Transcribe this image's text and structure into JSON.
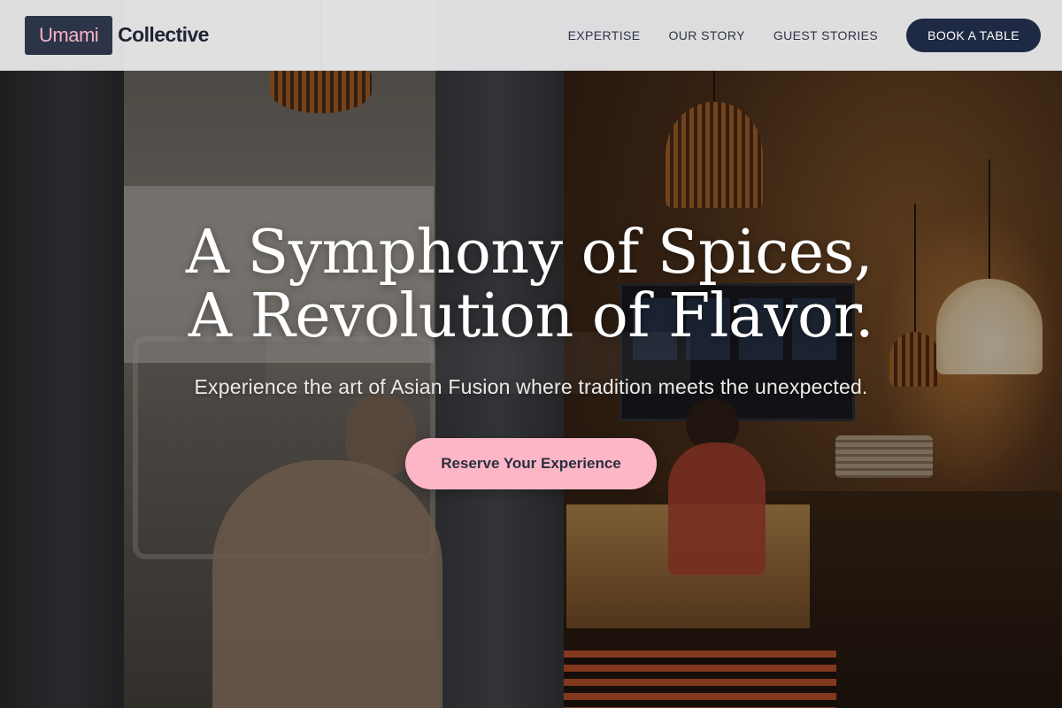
{
  "header": {
    "logo": {
      "highlight": "Umami",
      "rest": "Collective"
    },
    "nav": [
      {
        "label": "EXPERTISE"
      },
      {
        "label": "OUR STORY"
      },
      {
        "label": "GUEST STORIES"
      }
    ],
    "book_button": "BOOK A TABLE"
  },
  "hero": {
    "headline_line_1": "A Symphony of Spices,",
    "headline_line_2": "A Revolution of Flavor.",
    "subheadline": "Experience the art of Asian Fusion where tradition meets the unexpected.",
    "cta": "Reserve Your Experience"
  },
  "colors": {
    "header_bg": "#ececee",
    "logo_box": "#2c3448",
    "logo_highlight": "#f7b3c3",
    "nav_text": "#2e3447",
    "book_button_bg": "#1e2a44",
    "cta_bg": "#fdb6c6",
    "cta_text": "#2a2f3f"
  }
}
